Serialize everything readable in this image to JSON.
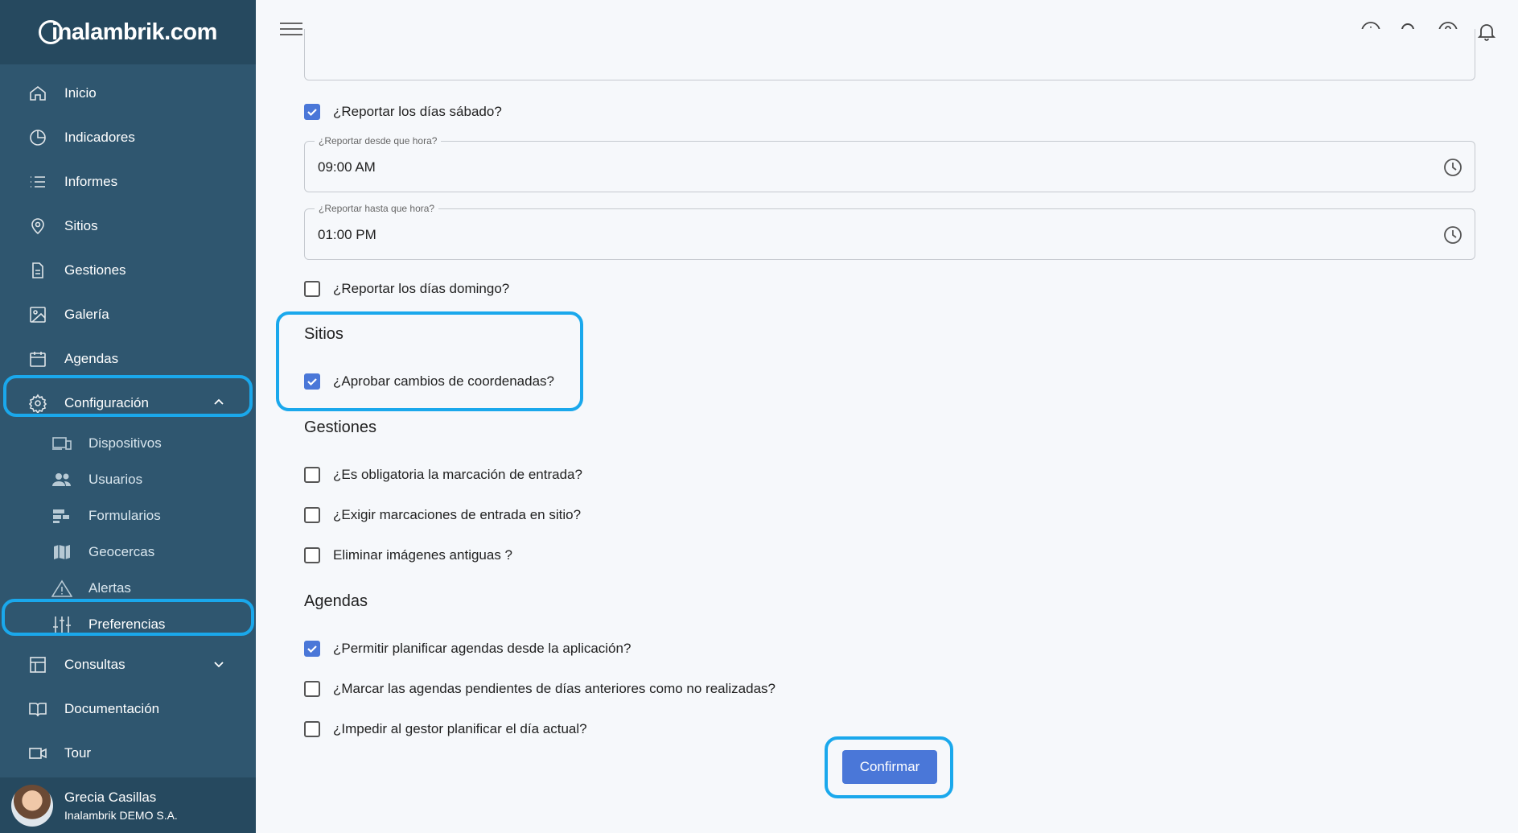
{
  "brand": {
    "logo_text": "inalambrik.com"
  },
  "sidebar": {
    "items": [
      {
        "label": "Inicio",
        "icon": "home-icon"
      },
      {
        "label": "Indicadores",
        "icon": "pie-chart-icon"
      },
      {
        "label": "Informes",
        "icon": "list-icon"
      },
      {
        "label": "Sitios",
        "icon": "location-pin-icon"
      },
      {
        "label": "Gestiones",
        "icon": "document-icon"
      },
      {
        "label": "Galería",
        "icon": "image-icon"
      },
      {
        "label": "Agendas",
        "icon": "calendar-icon"
      },
      {
        "label": "Configuración",
        "icon": "gear-icon",
        "expanded": true
      }
    ],
    "subitems": [
      {
        "label": "Dispositivos",
        "icon": "devices-icon"
      },
      {
        "label": "Usuarios",
        "icon": "users-icon"
      },
      {
        "label": "Formularios",
        "icon": "form-icon"
      },
      {
        "label": "Geocercas",
        "icon": "map-icon"
      },
      {
        "label": "Alertas",
        "icon": "warning-icon"
      },
      {
        "label": "Preferencias",
        "icon": "sliders-icon",
        "active": true
      }
    ],
    "bottom_items": [
      {
        "label": "Consultas",
        "icon": "table-icon"
      },
      {
        "label": "Documentación",
        "icon": "book-icon"
      },
      {
        "label": "Tour",
        "icon": "video-icon"
      }
    ]
  },
  "user": {
    "name": "Grecia Casillas",
    "org": "Inalambrik DEMO S.A."
  },
  "topbar": {
    "icons": [
      "info-icon",
      "search-icon",
      "help-icon",
      "bell-icon"
    ]
  },
  "form": {
    "saturday": {
      "label": "¿Reportar los días sábado?",
      "checked": true
    },
    "from_time": {
      "label": "¿Reportar desde que hora?",
      "value": "09:00 AM"
    },
    "to_time": {
      "label": "¿Reportar hasta que hora?",
      "value": "01:00 PM"
    },
    "sunday": {
      "label": "¿Reportar los días domingo?",
      "checked": false
    },
    "sitios": {
      "title": "Sitios",
      "approve_coords": {
        "label": "¿Aprobar cambios de coordenadas?",
        "checked": true
      }
    },
    "gestiones": {
      "title": "Gestiones",
      "mandatory_entry": {
        "label": "¿Es obligatoria la marcación de entrada?",
        "checked": false
      },
      "require_entry_site": {
        "label": "¿Exigir marcaciones de entrada en sitio?",
        "checked": false
      },
      "delete_images": {
        "label": "Eliminar imágenes antiguas ?",
        "checked": false
      }
    },
    "agendas": {
      "title": "Agendas",
      "allow_app_planning": {
        "label": "¿Permitir planificar agendas desde la aplicación?",
        "checked": true
      },
      "mark_pending": {
        "label": "¿Marcar las agendas pendientes de días anteriores como no realizadas?",
        "checked": false
      },
      "prevent_today": {
        "label": "¿Impedir al gestor planificar el día actual?",
        "checked": false
      }
    },
    "confirm_label": "Confirmar"
  },
  "colors": {
    "sidebar": "#2f566f",
    "brand_bar": "#26495f",
    "accent": "#4a77d8",
    "highlight": "#1aa8ec"
  }
}
